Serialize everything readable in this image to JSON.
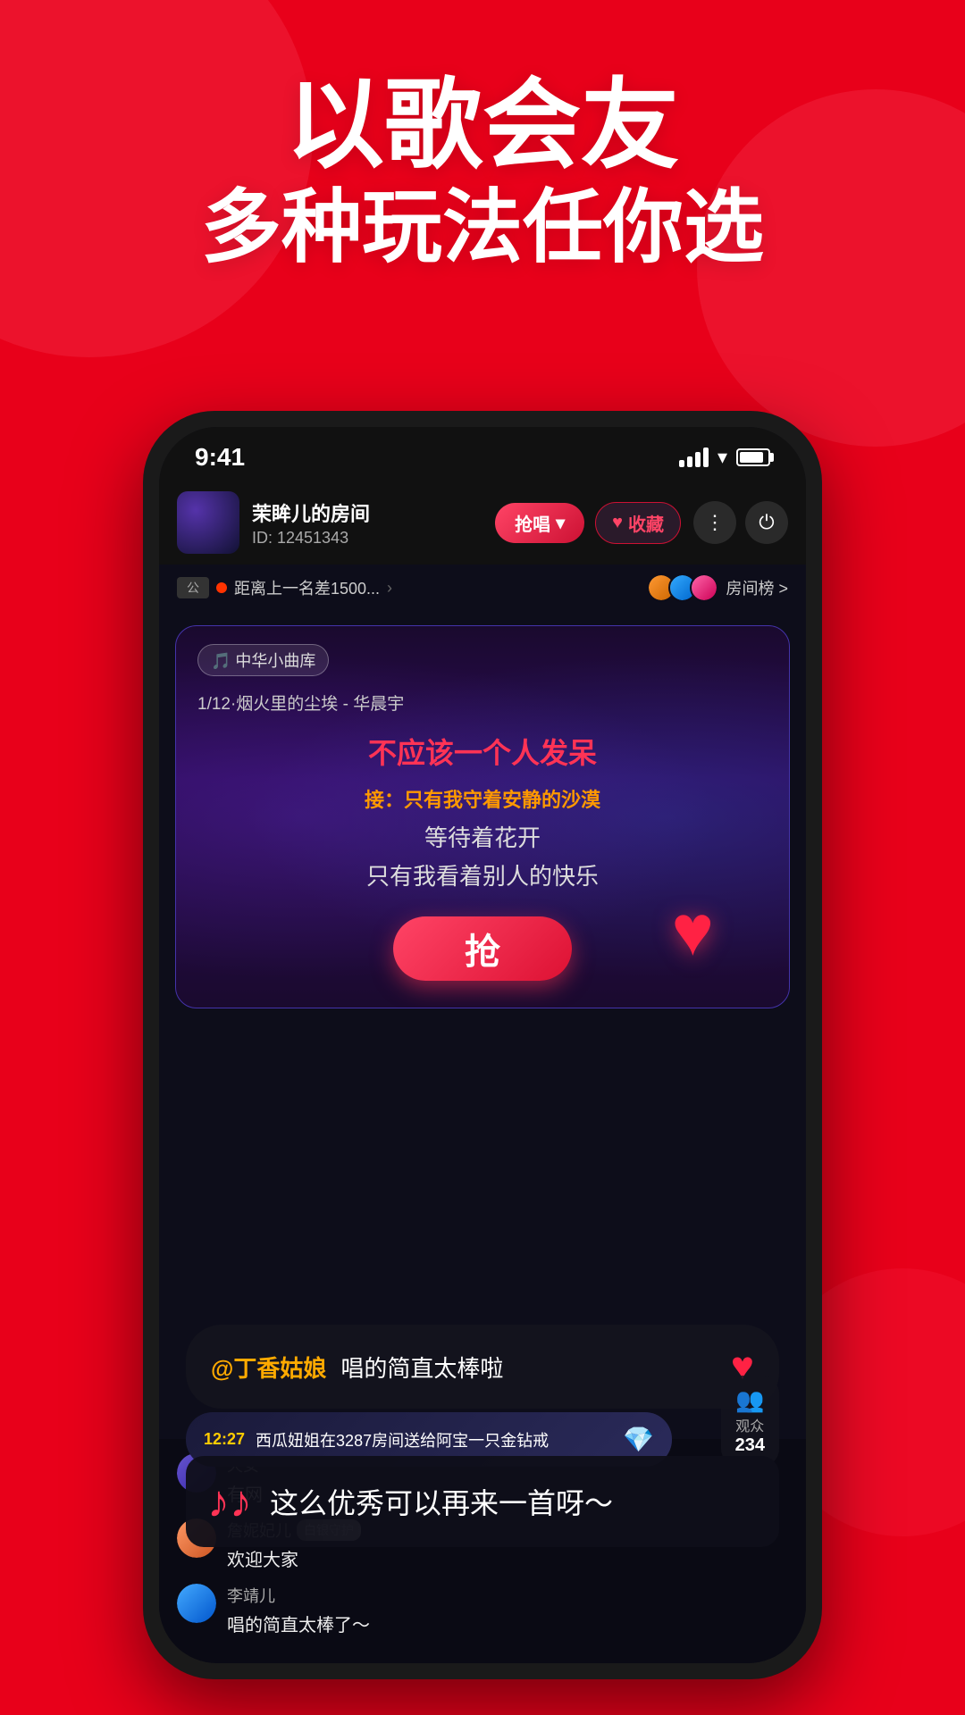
{
  "background": {
    "color": "#e8001a"
  },
  "hero": {
    "line1": "以歌会友",
    "line2": "多种玩法任你选"
  },
  "status_bar": {
    "time": "9:41",
    "battery_level": "85"
  },
  "room": {
    "name": "茉眸儿的房间",
    "id": "ID: 12451343",
    "btn_qiang": "抢唱",
    "btn_shoucang": "收藏",
    "notice_text": "距离上一名差1500...",
    "rank_label": "房间榜 >"
  },
  "song_card": {
    "lib_label": "🎵 中华小曲库",
    "meta": "1/12·烟火里的尘埃 - 华晨宇",
    "lyrics_main": "不应该一个人发呆",
    "lyrics_next_prefix": "接：",
    "lyrics_next": "只有我守着安静的沙漠",
    "lyrics_next2": "等待着花开",
    "lyrics_next3": "只有我看着别人的快乐",
    "grab_btn": "抢"
  },
  "comment": {
    "mention": "@丁香姑娘",
    "text": "唱的简直太棒啦"
  },
  "gift": {
    "time": "12:27",
    "text": "西瓜妞姐在3287房间送给阿宝一只金钻戒"
  },
  "audience": {
    "label": "观众",
    "count": "234"
  },
  "music_popup": {
    "text": "这么优秀可以再来一首呀～"
  },
  "chat": {
    "items": [
      {
        "username": "天女",
        "badge": "",
        "message": "有网"
      },
      {
        "username": "詹妮妃儿",
        "badge": "白银守护",
        "message": "欢迎大家"
      },
      {
        "username": "李靖儿",
        "badge": "",
        "message": "唱的简直太棒了～"
      }
    ]
  }
}
